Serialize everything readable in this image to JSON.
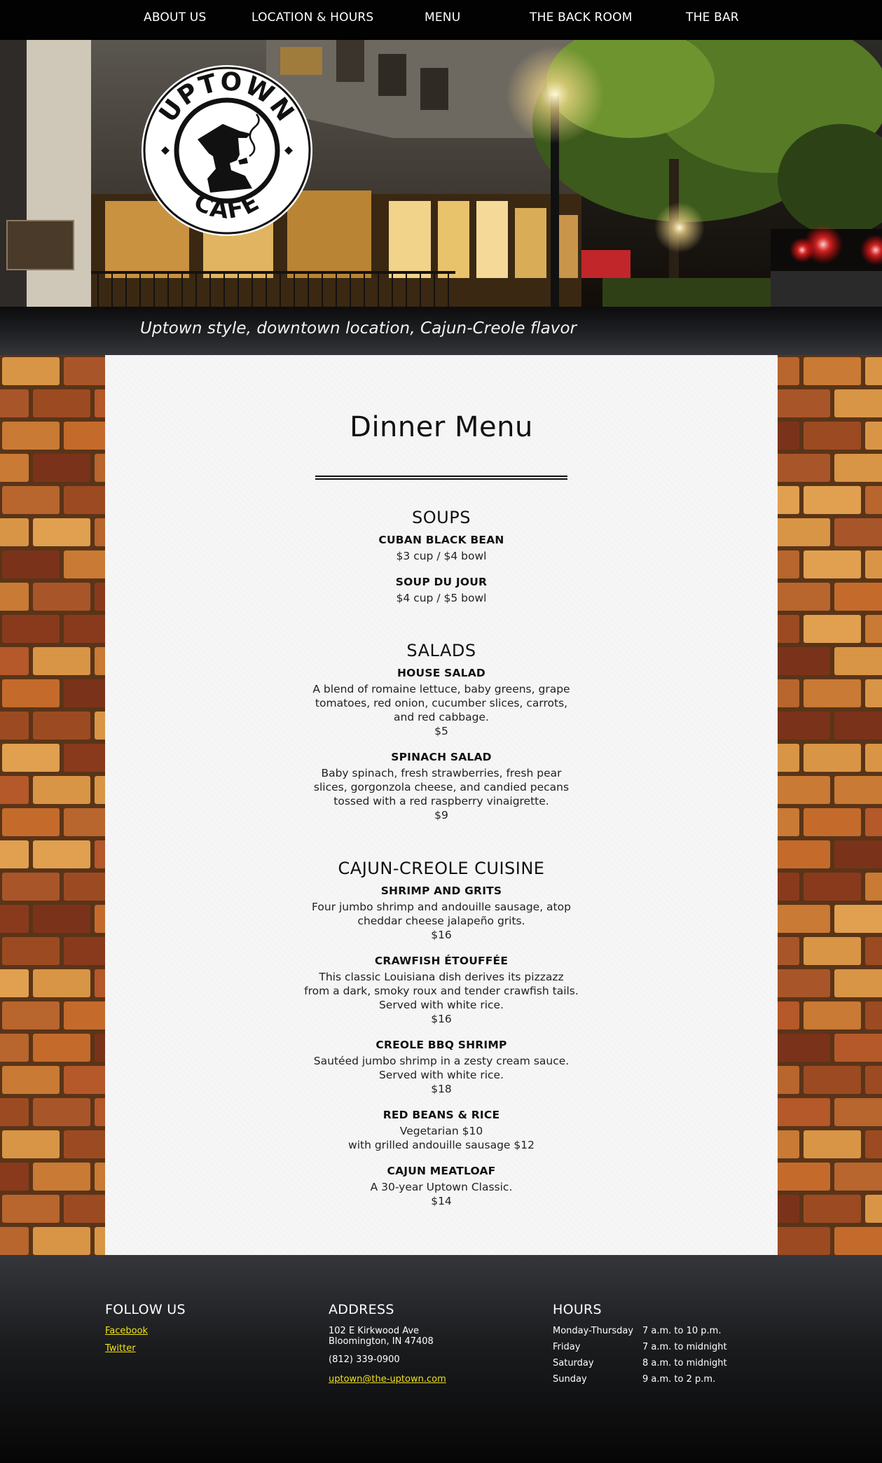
{
  "nav": {
    "items": [
      {
        "label": "ABOUT US"
      },
      {
        "label": "LOCATION & HOURS"
      },
      {
        "label": "MENU"
      },
      {
        "label": "THE BACK ROOM"
      },
      {
        "label": "THE BAR"
      }
    ]
  },
  "hero": {
    "logo_top_text": "UPTOWN",
    "logo_bottom_text": "CAFE",
    "tagline": "Uptown style, downtown location, Cajun-Creole flavor"
  },
  "menu": {
    "title": "Dinner Menu",
    "sections": [
      {
        "heading": "SOUPS",
        "items": [
          {
            "name": "CUBAN BLACK BEAN",
            "lines": [
              "$3 cup / $4 bowl"
            ]
          },
          {
            "name": "SOUP DU JOUR",
            "lines": [
              "$4 cup / $5 bowl"
            ]
          }
        ]
      },
      {
        "heading": "SALADS",
        "items": [
          {
            "name": "HOUSE SALAD",
            "lines": [
              "A blend of romaine lettuce, baby greens, grape",
              "tomatoes, red onion, cucumber slices, carrots,",
              "and red cabbage.",
              "$5"
            ]
          },
          {
            "name": "SPINACH SALAD",
            "lines": [
              "Baby spinach, fresh strawberries, fresh pear",
              "slices, gorgonzola cheese, and candied pecans",
              "tossed with a red raspberry vinaigrette.",
              "$9"
            ]
          }
        ]
      },
      {
        "heading": "CAJUN-CREOLE CUISINE",
        "items": [
          {
            "name": "SHRIMP AND GRITS",
            "lines": [
              "Four jumbo shrimp and andouille sausage, atop",
              "cheddar cheese jalapeño grits.",
              "$16"
            ]
          },
          {
            "name": "CRAWFISH ÉTOUFFÉE",
            "lines": [
              "This classic Louisiana dish derives its pizzazz",
              "from a dark, smoky roux and tender crawfish tails.",
              "Served with white rice.",
              "$16"
            ]
          },
          {
            "name": "CREOLE BBQ SHRIMP",
            "lines": [
              "Sautéed jumbo shrimp in a zesty cream sauce.",
              "Served with white rice.",
              "$18"
            ]
          },
          {
            "name": "RED BEANS & RICE",
            "lines": [
              "Vegetarian $10",
              "with grilled andouille sausage $12"
            ]
          },
          {
            "name": "CAJUN MEATLOAF",
            "lines": [
              "A 30-year Uptown Classic.",
              "$14"
            ]
          }
        ]
      }
    ]
  },
  "footer": {
    "follow": {
      "heading": "FOLLOW US",
      "links": [
        "Facebook",
        "Twitter"
      ]
    },
    "address": {
      "heading": "ADDRESS",
      "street": "102 E Kirkwood Ave",
      "city": "Bloomington, IN 47408",
      "phone": "(812) 339-0900",
      "email": "uptown@the-uptown.com"
    },
    "hours": {
      "heading": "HOURS",
      "rows": [
        {
          "day": "Monday-Thursday",
          "time": "7 a.m. to 10 p.m."
        },
        {
          "day": "Friday",
          "time": "7 a.m. to midnight"
        },
        {
          "day": "Saturday",
          "time": "8 a.m. to midnight"
        },
        {
          "day": "Sunday",
          "time": "9 a.m. to 2 p.m."
        }
      ]
    }
  },
  "colors": {
    "link_yellow": "#f0e11b",
    "nav_bg": "#020202",
    "paper": "#f6f6f6"
  }
}
